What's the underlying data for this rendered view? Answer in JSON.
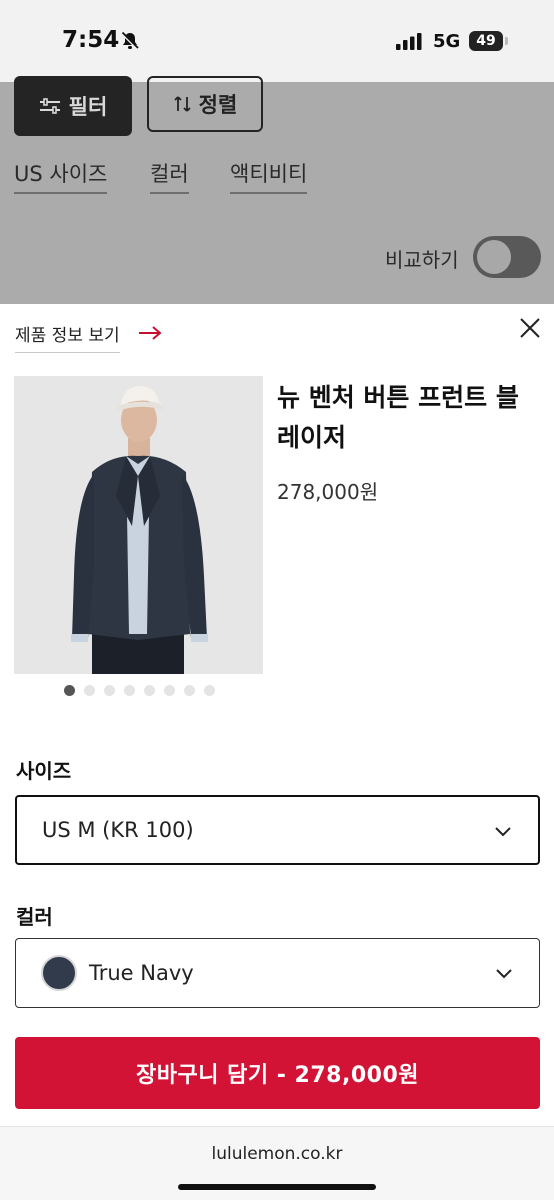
{
  "status_bar": {
    "time": "7:54",
    "network": "5G",
    "battery": "49"
  },
  "background_page": {
    "filter_label": "필터",
    "sort_label": "정렬",
    "chips": [
      "US 사이즈",
      "컬러",
      "액티비티"
    ],
    "compare_label": "비교하기"
  },
  "sheet": {
    "view_info_label": "제품 정보 보기",
    "product_name": "뉴 벤처 버튼 프런트 블레이저",
    "product_price": "278,000원",
    "image_count": 8,
    "active_image_index": 0,
    "size_label": "사이즈",
    "size_value": "US M (KR 100)",
    "color_label": "컬러",
    "color_value": "True Navy",
    "swatch_color": "#323b4c",
    "cart_button_label": "장바구니 담기 - 278,000원",
    "accent_color": "#d31336"
  },
  "browser": {
    "url": "lululemon.co.kr"
  }
}
